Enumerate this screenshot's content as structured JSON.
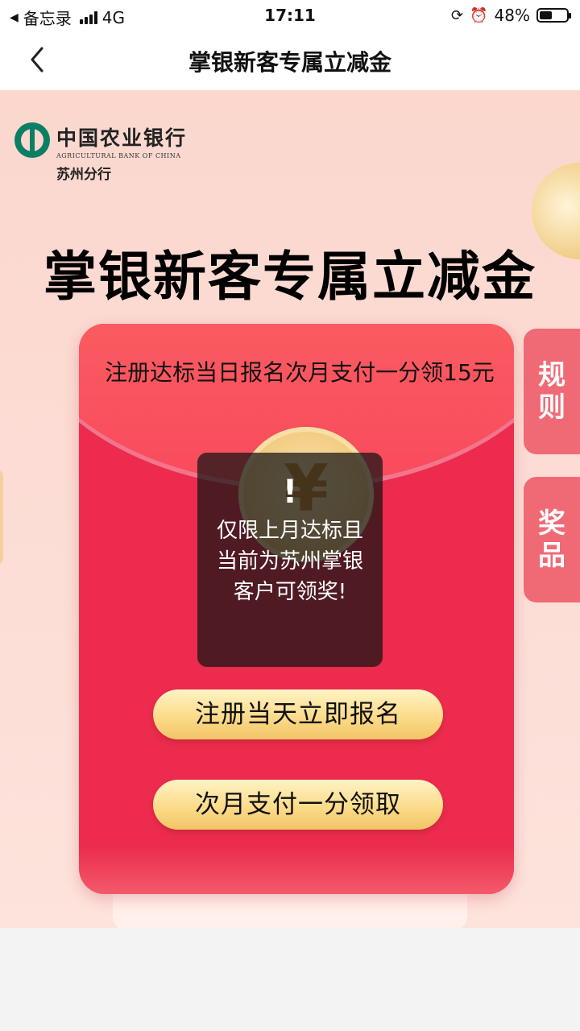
{
  "status_bar": {
    "back_app": "备忘录",
    "network": "4G",
    "time": "17:11",
    "battery": "48%",
    "battery_level": 0.48
  },
  "nav": {
    "title": "掌银新客专属立减金",
    "back_icon": "chevron-left-icon"
  },
  "brand": {
    "name_cn": "中国农业银行",
    "name_en": "AGRICULTURAL BANK OF CHINA",
    "branch": "苏州分行"
  },
  "banner": {
    "title": "掌银新客专属立减金"
  },
  "envelope": {
    "headline": "注册达标当日报名次月支付一分领15元",
    "coin_symbol": "¥",
    "signup_button": "注册当天立即报名",
    "pay_button": "次月支付一分领取"
  },
  "side_tabs": {
    "rules_1": "规",
    "rules_2": "则",
    "prizes_1": "奖",
    "prizes_2": "品"
  },
  "toast": {
    "icon": "!",
    "message": "仅限上月达标且当前为苏州掌银客户可领奖!"
  },
  "colors": {
    "banner_bg": "#fbd7ce",
    "envelope_red": "#ec2b4e",
    "button_gold": "#fbd986",
    "tab_pink": "#f06a75",
    "abc_green": "#0a7f63"
  }
}
